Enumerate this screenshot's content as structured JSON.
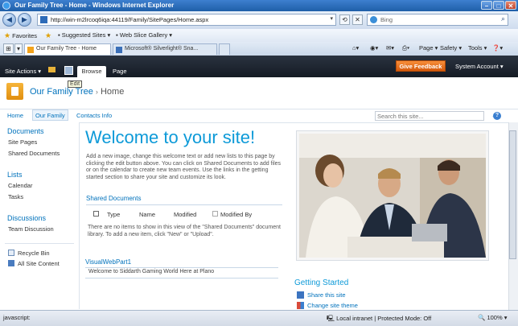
{
  "window": {
    "title": "Our Family Tree - Home - Windows Internet Explorer"
  },
  "address": {
    "url": "http://win-m2lrcoq6iqa:44119/Family/SitePages/Home.aspx",
    "search_placeholder": "Bing"
  },
  "favorites": {
    "label": "Favorites",
    "items": [
      "Suggested Sites",
      "Web Slice Gallery"
    ]
  },
  "tabs": [
    {
      "label": "Our Family Tree - Home"
    },
    {
      "label": "Microsoft® Silverlight® Sna..."
    }
  ],
  "commands": [
    "Page",
    "Safety",
    "Tools"
  ],
  "ribbon": {
    "site_actions": "Site Actions",
    "edit_tooltip": "Edit",
    "browse": "Browse",
    "page": "Page",
    "give_feedback": "Give Feedback",
    "system_account": "System Account"
  },
  "site": {
    "title": "Our Family Tree",
    "breadcrumb_sep": "›",
    "page": "Home"
  },
  "topnav": {
    "home": "Home",
    "our_family": "Our Family",
    "contacts": "Contacts Info",
    "search_placeholder": "Search this site..."
  },
  "leftnav": {
    "documents_head": "Documents",
    "site_pages": "Site Pages",
    "shared_documents": "Shared Documents",
    "lists_head": "Lists",
    "calendar": "Calendar",
    "tasks": "Tasks",
    "discussions_head": "Discussions",
    "team_discussion": "Team Discussion",
    "recycle_bin": "Recycle Bin",
    "all_site_content": "All Site Content"
  },
  "main": {
    "welcome": "Welcome to your site!",
    "intro": "Add a new image, change this welcome text or add new lists to this page by clicking the edit button above. You can click on Shared Documents to add files or on the calendar to create new team events. Use the links in the getting started section to share your site and customize its look.",
    "shared_docs_title": "Shared Documents",
    "columns": [
      "Type",
      "Name",
      "Modified",
      "Modified By"
    ],
    "empty_msg": "There are no items to show in this view of the \"Shared Documents\" document library. To add a new item, click \"New\" or \"Upload\".",
    "webpart_title": "VisualWebPart1",
    "webpart_text": "Welcome to Siddarth Gaming World Here at Plano"
  },
  "getting_started": {
    "title": "Getting Started",
    "items": [
      "Share this site",
      "Change site theme"
    ]
  },
  "status": {
    "left": "javascript:",
    "zone": "Local intranet | Protected Mode: Off",
    "zoom": "100%"
  },
  "colors": {
    "sp_blue": "#0072bc",
    "welcome_blue": "#0d9ad8",
    "feedback_orange": "#e8731e",
    "ribbon_dark": "#1e2630"
  }
}
